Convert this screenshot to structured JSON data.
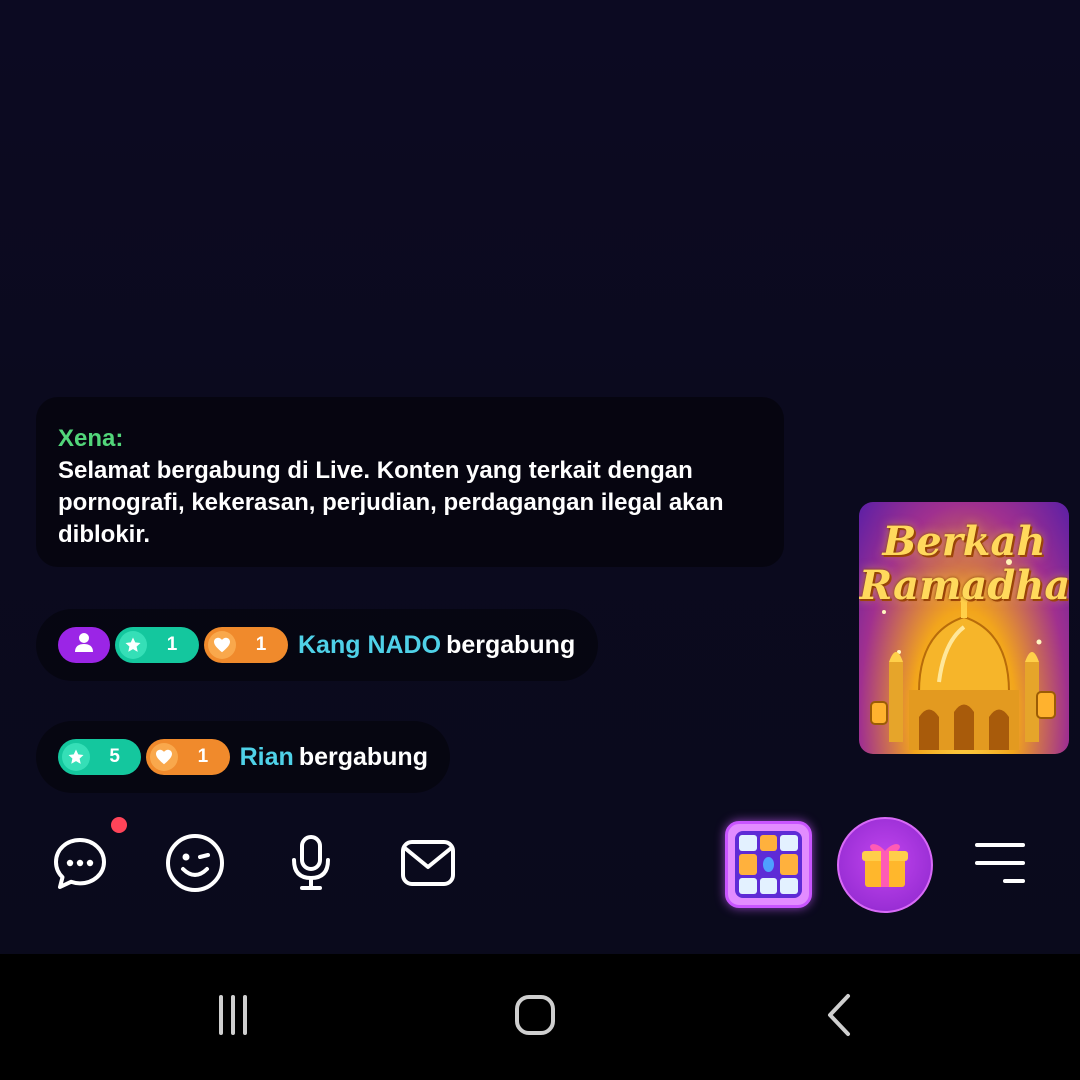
{
  "chat": {
    "system_message": {
      "sender": "Xena:",
      "text": "Selamat bergabung di Live. Konten yang terkait dengan pornografi, kekerasan, perjudian, perdagangan ilegal akan diblokir."
    },
    "join_events": [
      {
        "badges": {
          "level": "1",
          "fans": "1"
        },
        "username": "Kang NADO",
        "action": "bergabung"
      },
      {
        "badges": {
          "level": "5",
          "fans": "1"
        },
        "username": "Rian",
        "action": "bergabung"
      }
    ]
  },
  "promo": {
    "title_line1": "Berkah",
    "title_line2": "Ramadhan"
  },
  "toolbar": {
    "items": [
      "chat-bubble-icon",
      "emoji-wink-icon",
      "microphone-icon",
      "mail-icon",
      "games-grid-icon",
      "gift-icon",
      "menu-icon"
    ],
    "has_chat_notification": true
  },
  "colors": {
    "sender_name": "#52d67a",
    "username": "#4fd1e8",
    "level_badge": "#14c79e",
    "fans_badge": "#f08a2c",
    "user_badge": "#9b25e6",
    "notification_dot": "#ff4459"
  },
  "system_nav": [
    "recent-apps-icon",
    "home-icon",
    "back-icon"
  ]
}
